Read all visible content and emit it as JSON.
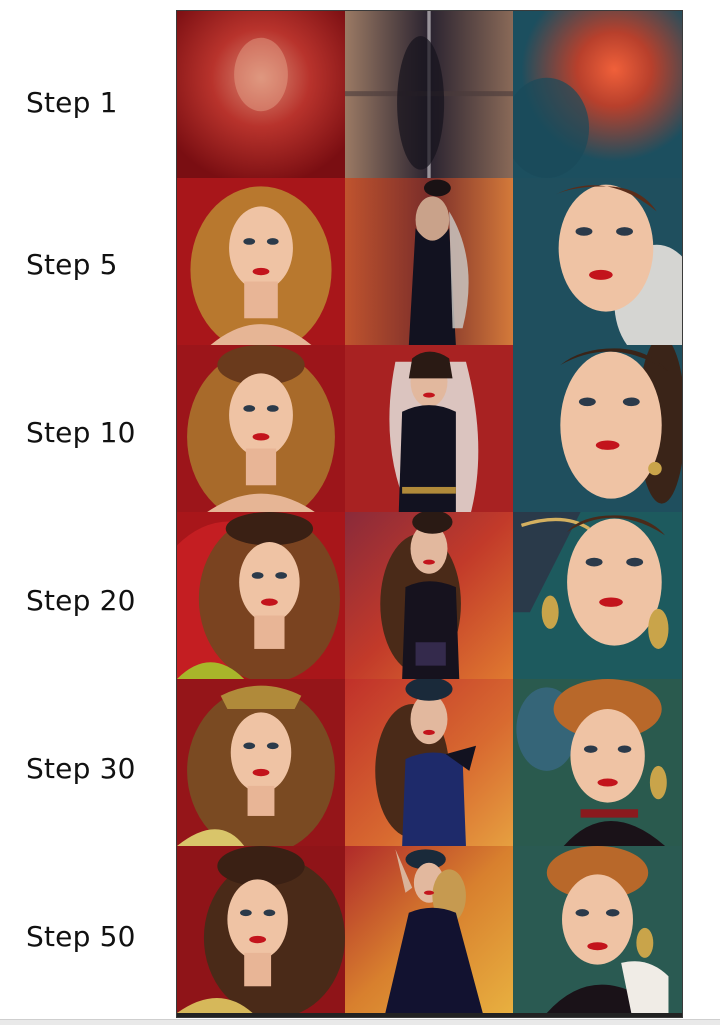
{
  "rows": [
    {
      "label": "Step 1"
    },
    {
      "label": "Step 5"
    },
    {
      "label": "Step 10"
    },
    {
      "label": "Step 20"
    },
    {
      "label": "Step 30"
    },
    {
      "label": "Step 50"
    }
  ],
  "palette": {
    "red_bg": "#a8161a",
    "dark_red_bg": "#6e0f12",
    "teal_bg": "#1f4f5e",
    "skin": "#efc3a4",
    "hair_blonde": "#b8782e",
    "hair_brown": "#4a2a18",
    "dress_dark": "#121220",
    "lips": "#c3141c"
  }
}
